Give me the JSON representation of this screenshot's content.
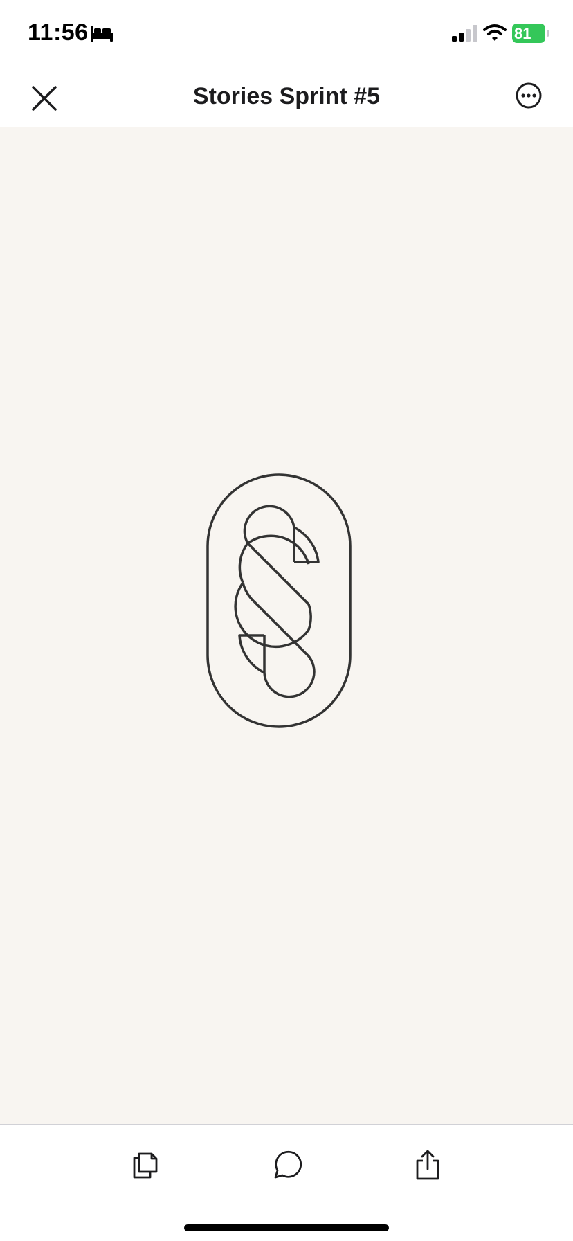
{
  "status_bar": {
    "time": "11:56",
    "battery_level": "81",
    "battery_color": "#34c759",
    "icons": [
      "sleep-icon",
      "signal-icon",
      "wifi-icon",
      "battery-icon"
    ]
  },
  "nav": {
    "title": "Stories Sprint #5",
    "close_icon": "close-icon",
    "more_icon": "more-options-icon"
  },
  "content": {
    "background_color": "#f8f5f1",
    "logo": "stories-logo-icon",
    "logo_color": "#333333"
  },
  "toolbar": {
    "icons": [
      "copy-icon",
      "comment-icon",
      "share-icon"
    ]
  }
}
